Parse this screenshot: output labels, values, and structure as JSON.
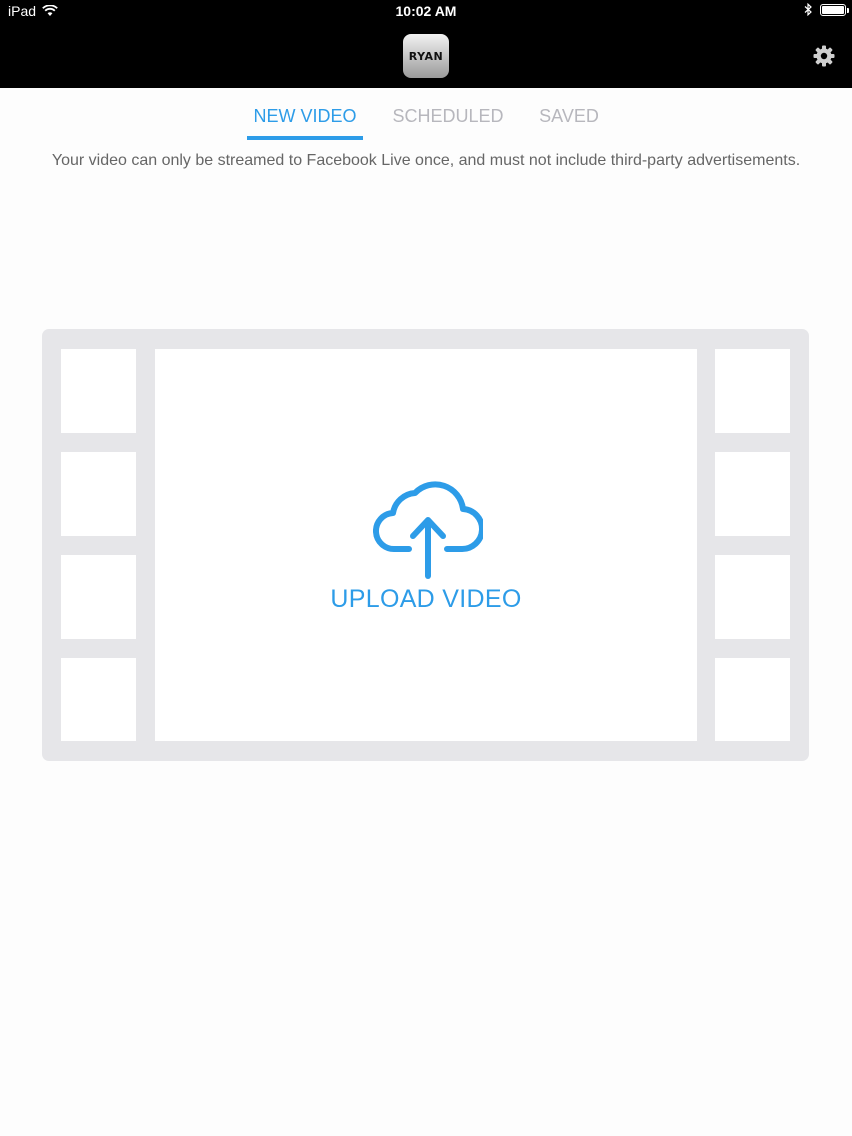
{
  "status_bar": {
    "carrier": "iPad",
    "time": "10:02 AM"
  },
  "header": {
    "logo_text": "RYAN",
    "settings_icon": "gear-icon"
  },
  "tabs": [
    {
      "label": "NEW VIDEO",
      "active": true
    },
    {
      "label": "SCHEDULED",
      "active": false
    },
    {
      "label": "SAVED",
      "active": false
    }
  ],
  "notice": "Your video can only be streamed to Facebook Live once, and must not include third-party advertisements.",
  "upload": {
    "label": "UPLOAD VIDEO",
    "icon": "cloud-upload-icon"
  },
  "colors": {
    "accent": "#2d9ce8",
    "inactive_tab": "#b7b7bd",
    "film_strip": "#e6e6e9"
  }
}
